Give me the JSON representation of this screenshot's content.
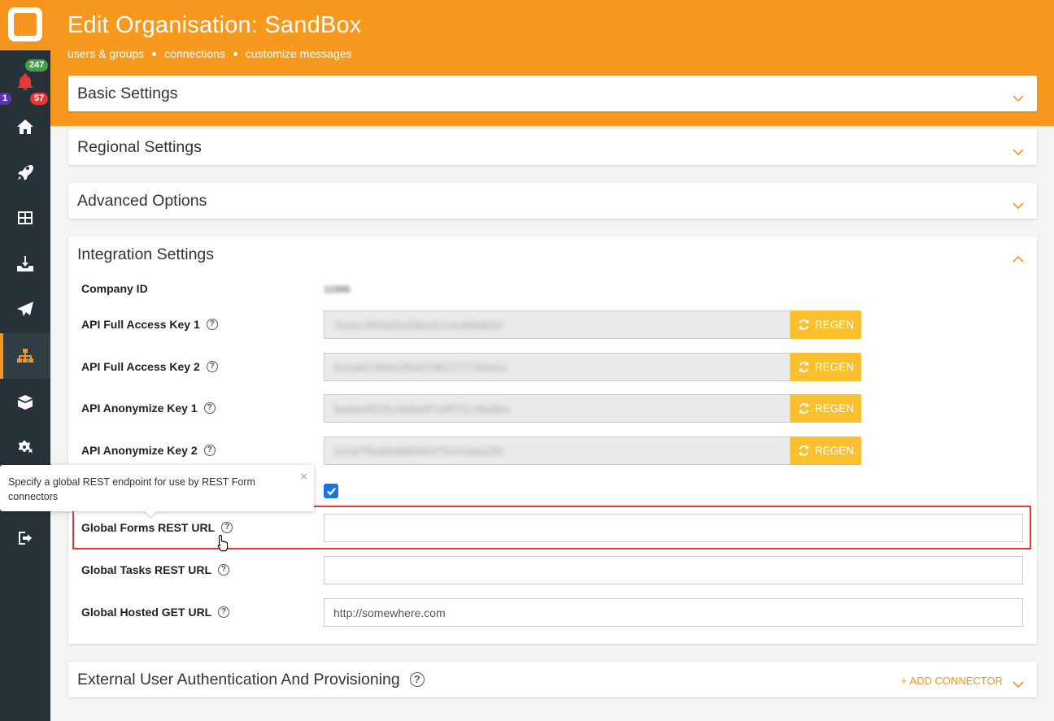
{
  "sidebar": {
    "badges": {
      "notifications_green": "247",
      "notifications_red": "57",
      "notifications_purple": "1"
    },
    "icons": [
      "bell-icon",
      "home-icon",
      "rocket-icon",
      "dashboard-icon",
      "inbox-download-icon",
      "paper-plane-icon",
      "sitemap-icon",
      "box-open-icon",
      "gears-icon",
      "sign-out-icon"
    ],
    "active": "sitemap-icon"
  },
  "header": {
    "title": "Edit Organisation: SandBox",
    "subnav": [
      "users & groups",
      "connections",
      "customize messages"
    ]
  },
  "panels": {
    "basic": "Basic Settings",
    "regional": "Regional Settings",
    "advanced": "Advanced Options",
    "integration": "Integration Settings",
    "external": "External User Authentication And Provisioning",
    "add_connector": "+ ADD CONNECTOR"
  },
  "integration": {
    "company_id_label": "Company ID",
    "company_id_value": "11986",
    "keys": [
      {
        "label": "API Full Access Key 1",
        "value": "7bcec3f43af2ef3be2c14e8f9db00"
      },
      {
        "label": "API Full Access Key 2",
        "value": "6c4a65390b1ff9431f62277740e0a"
      },
      {
        "label": "API Anonymize Key 1",
        "value": "6adae8f1f5c4b6a9f7e9f7f1c3fa9be"
      },
      {
        "label": "API Anonymize Key 2",
        "value": "2c0d7f5a6b96806f1f7620c6da2f0"
      }
    ],
    "regen_label": "REGEN",
    "global_forms_label": "Global Forms REST URL",
    "global_forms_value": "",
    "global_tasks_label": "Global Tasks REST URL",
    "global_tasks_value": "",
    "global_hosted_label": "Global Hosted GET URL",
    "global_hosted_value": "http://somewhere.com"
  },
  "tooltip": {
    "text": "Specify a global REST endpoint for use by REST Form connectors",
    "close": "×"
  },
  "help_glyph": "?",
  "colors": {
    "accent": "#f7991f",
    "regen": "#fbc02d",
    "sidebar": "#263238",
    "highlight": "#e53935"
  }
}
